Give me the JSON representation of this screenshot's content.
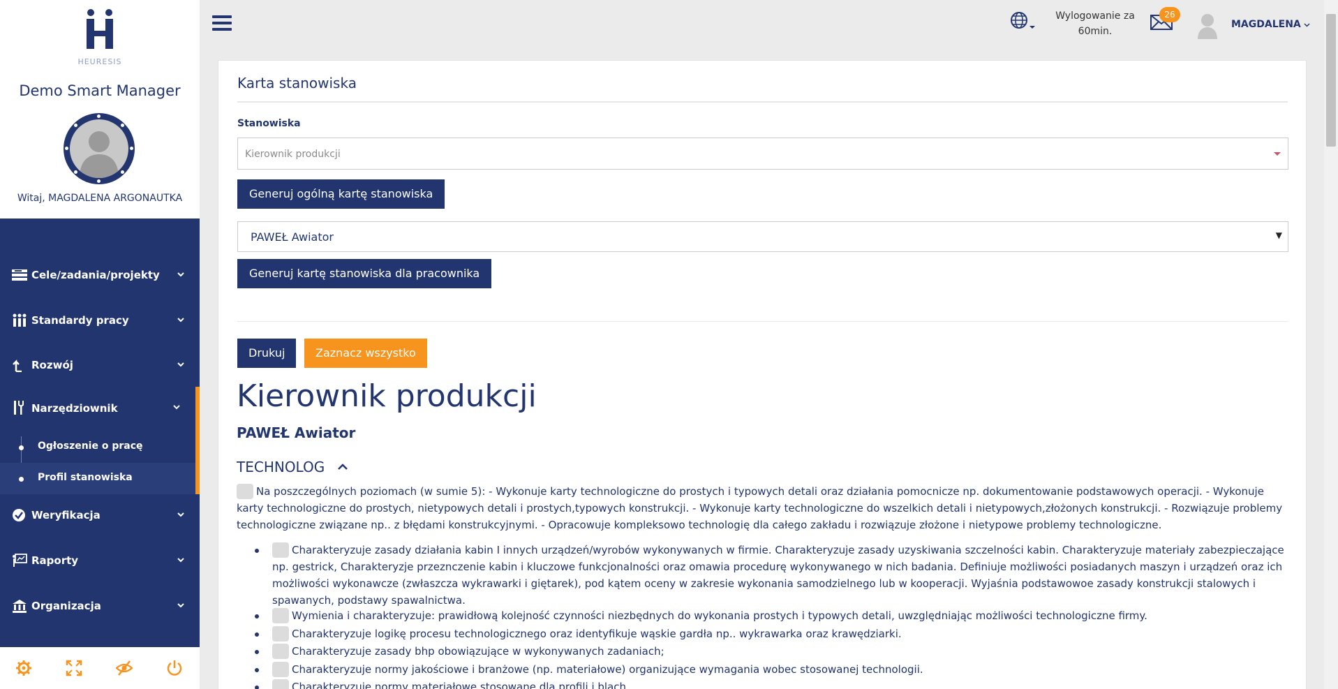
{
  "app": {
    "logo_text": "HEURESIS",
    "title": "Demo Smart Manager",
    "welcome": "Witaj, MAGDALENA ARGONAUTKA"
  },
  "colors": {
    "navy": "#22356f",
    "orange": "#f7941d"
  },
  "nav": {
    "items": [
      {
        "label": "Cele/zadania/projekty",
        "icon": "tasks-icon"
      },
      {
        "label": "Standardy pracy",
        "icon": "people-icon"
      },
      {
        "label": "Rozwój",
        "icon": "growth-icon"
      },
      {
        "label": "Narzędziownik",
        "icon": "tools-icon"
      },
      {
        "label": "Weryfikacja",
        "icon": "check-icon"
      },
      {
        "label": "Raporty",
        "icon": "report-icon"
      },
      {
        "label": "Organizacja",
        "icon": "building-icon"
      }
    ],
    "subitems": [
      {
        "label": "Ogłoszenie o pracę"
      },
      {
        "label": "Profil stanowiska"
      }
    ]
  },
  "header": {
    "logout_line1": "Wylogowanie za",
    "logout_line2": "60min.",
    "mail_count": "26",
    "user_name": "MAGDALENA"
  },
  "main": {
    "title": "Karta stanowiska",
    "field_label": "Stanowiska",
    "position_select": "Kierownik produkcji",
    "btn_general": "Generuj ogólną kartę stanowiska",
    "employee_select": "PAWEŁ Awiator",
    "btn_employee": "Generuj kartę stanowiska dla pracownika",
    "btn_print": "Drukuj",
    "btn_select_all": "Zaznacz wszystko",
    "card_title": "Kierownik produkcji",
    "card_employee": "PAWEŁ Awiator",
    "section_title": "TECHNOLOG",
    "intro": "Na poszczególnych poziomach (w sumie 5): - Wykonuje karty technologiczne do prostych i typowych detali oraz działania pomocnicze np. dokumentowanie podstawowych operacji. - Wykonuje karty technologiczne do prostych, nietypowych detali i prostych,typowych konstrukcji. - Wykonuje karty technologiczne do wszelkich detali i nietypowych,złożonych konstrukcji. - Rozwiązuje problemy technologiczne związane np.. z błędami konstrukcyjnymi. - Opracowuje kompleksowo technologię dla całego zakładu i rozwiązuje złożone i nietypowe problemy technologiczne.",
    "items": [
      "Charakteryzuje zasady działania kabin I innych urządzeń/wyrobów wykonywanych w firmie. Charakteryzuje zasady uzyskiwania szczelności kabin. Charakteryzuje materiały zabezpieczające np. gestrick, Charakteryzje przeznczenie kabin i kluczowe funkcjonalności oraz omawia procedurę wykonywanego w nich badania. Definiuje możliwości posiadanych maszyn i urządzeń oraz ich możliwości wykonawcze (zwłaszcza wykrawarki i giętarek), pod kątem oceny w zakresie wykonania samodzielnego lub w kooperacji. Wyjaśnia podstawowoe zasady konstrukcji stalowych i spawanych, podstawy spawalnictwa.",
      "Wymienia i charakteryzuje: prawidłową kolejność czynności niezbędnych do wykonania prostych i typowych detali, uwzględniając możliwości technologiczne firmy.",
      "Charakteryzuje logikę procesu technologicznego oraz identyfikuje wąskie gardła np.. wykrawarka oraz krawędziarki.",
      "Charakteryzuje zasady bhp obowiązujące w wykonywanych zadaniach;",
      "Charakteryzuje normy jakościowe i branżowe (np. materiałowe) organizujące wymagania wobec stosowanej technologii.",
      "Charakteryzuje normy materiałowe stosowane dla profili i blach"
    ]
  }
}
